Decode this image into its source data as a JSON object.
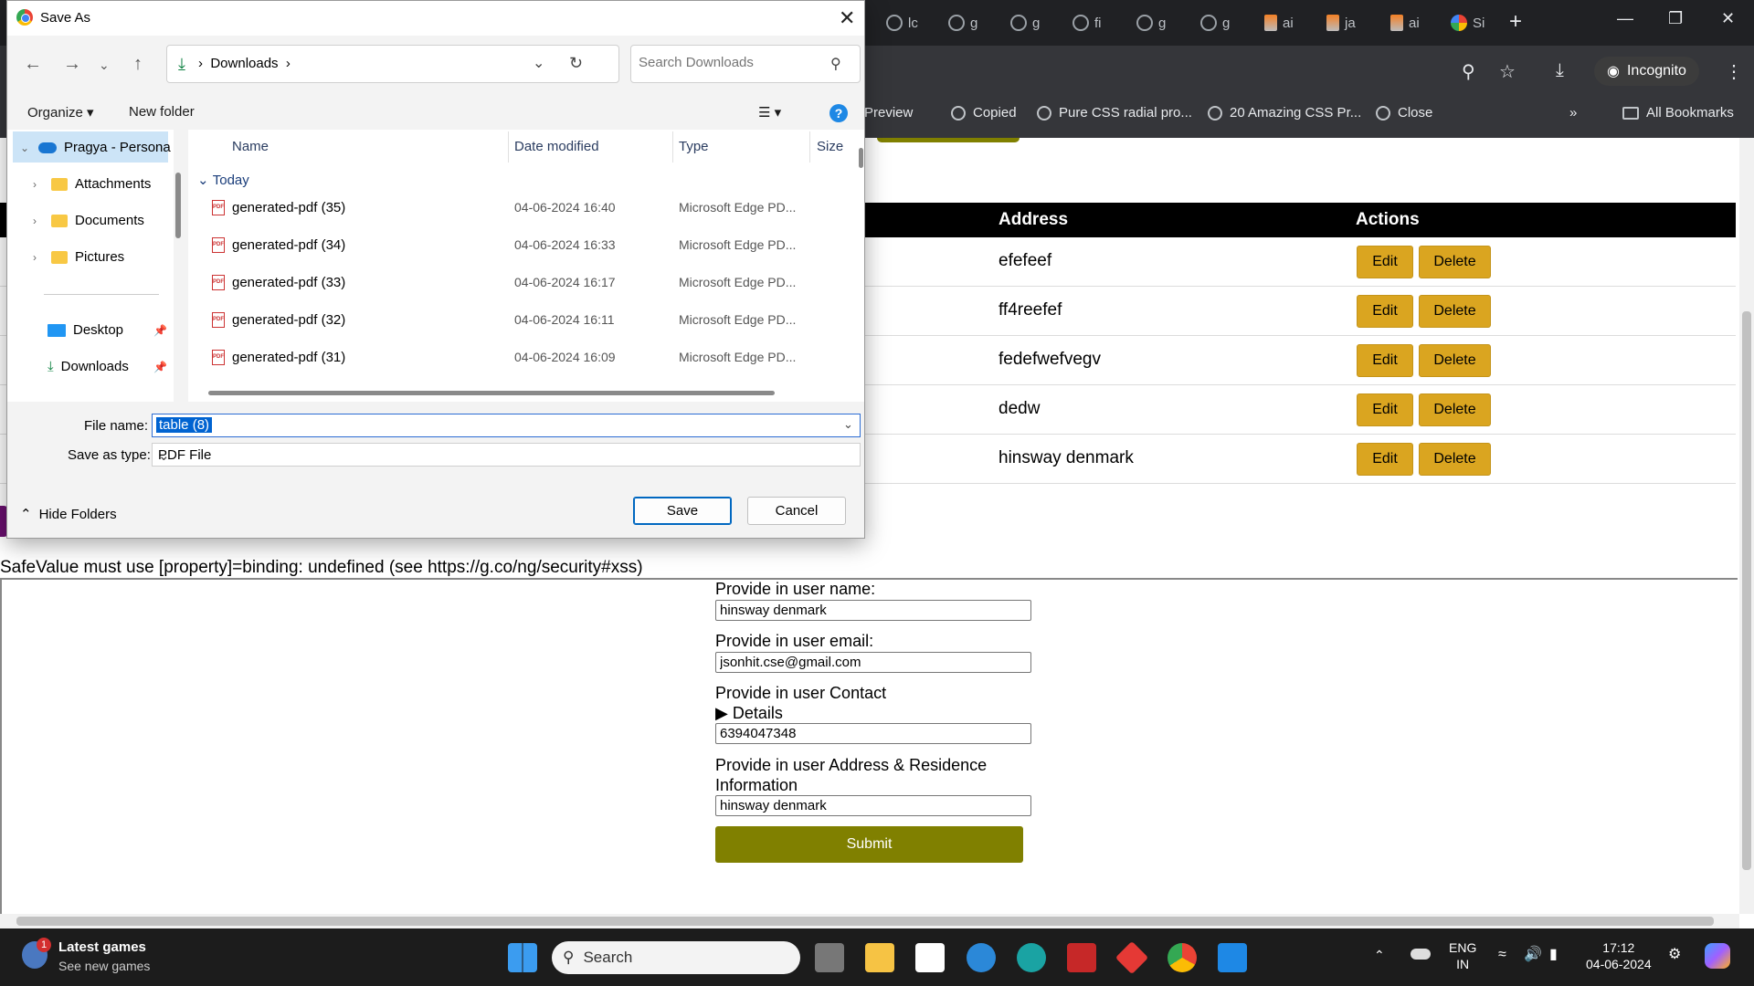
{
  "browser": {
    "tabs": [
      "lc",
      "g",
      "g",
      "fi",
      "g",
      "g",
      "ai",
      "ja",
      "ai",
      "Si"
    ],
    "incognito_label": "Incognito",
    "bookmarks": [
      "Preview",
      "Copied",
      "Pure CSS radial pro...",
      "20 Amazing CSS Pr...",
      "Close"
    ],
    "all_bookmarks": "All Bookmarks"
  },
  "table": {
    "headers": {
      "address": "Address",
      "actions": "Actions"
    },
    "rows": [
      "efefeef",
      "ff4reefef",
      "fedefwefvegv",
      "dedw",
      "hinsway denmark"
    ],
    "edit_label": "Edit",
    "delete_label": "Delete"
  },
  "form": {
    "error_text": "SafeValue must use [property]=binding: undefined (see https://g.co/ng/security#xss)",
    "name_label": "Provide in user name:",
    "name_value": "hinsway denmark",
    "email_label": "Provide in user email:",
    "email_value": "jsonhit.cse@gmail.com",
    "contact_label": "Provide in user Contact",
    "details_label": "Details",
    "contact_value": "6394047348",
    "address_label_1": "Provide in user Address & Residence",
    "address_label_2": "Information",
    "address_value": "hinsway denmark",
    "submit_label": "Submit"
  },
  "dialog": {
    "title": "Save As",
    "path": "Downloads",
    "search_placeholder": "Search Downloads",
    "organize": "Organize",
    "new_folder": "New folder",
    "nav": {
      "root": "Pragya - Persona",
      "items": [
        "Attachments",
        "Documents",
        "Pictures"
      ],
      "quick": [
        "Desktop",
        "Downloads"
      ]
    },
    "columns": {
      "name": "Name",
      "date": "Date modified",
      "type": "Type",
      "size": "Size"
    },
    "group": "Today",
    "files": [
      {
        "name": "generated-pdf (35)",
        "date": "04-06-2024 16:40",
        "type": "Microsoft Edge PD..."
      },
      {
        "name": "generated-pdf (34)",
        "date": "04-06-2024 16:33",
        "type": "Microsoft Edge PD..."
      },
      {
        "name": "generated-pdf (33)",
        "date": "04-06-2024 16:17",
        "type": "Microsoft Edge PD..."
      },
      {
        "name": "generated-pdf (32)",
        "date": "04-06-2024 16:11",
        "type": "Microsoft Edge PD..."
      },
      {
        "name": "generated-pdf (31)",
        "date": "04-06-2024 16:09",
        "type": "Microsoft Edge PD..."
      }
    ],
    "file_name_label": "File name:",
    "file_name_value": "table (8)",
    "save_type_label": "Save as type:",
    "save_type_value": "PDF File",
    "hide_folders": "Hide Folders",
    "save_label": "Save",
    "cancel_label": "Cancel"
  },
  "taskbar": {
    "widget_badge": "1",
    "widget_title": "Latest games",
    "widget_sub": "See new games",
    "search_label": "Search",
    "lang_1": "ENG",
    "lang_2": "IN",
    "time": "17:12",
    "date": "04-06-2024"
  },
  "colors": {
    "accent_olive": "#808000",
    "button_gold": "#daa520",
    "dialog_blue": "#0067c0"
  }
}
